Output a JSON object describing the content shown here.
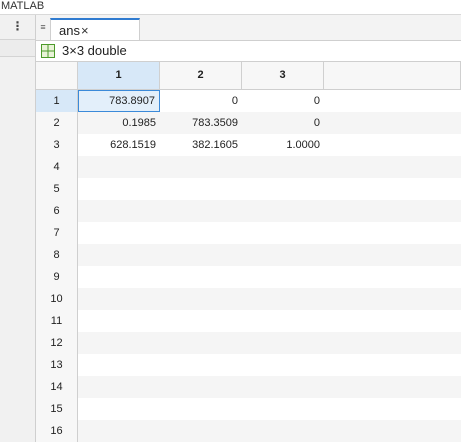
{
  "app": {
    "title": "MATLAB"
  },
  "left_panel": {
    "menu_icon": "kebab-icon"
  },
  "tabs": [
    {
      "label": "ans",
      "close": "×"
    }
  ],
  "variable": {
    "size_label": "3×3 double"
  },
  "columns": [
    "1",
    "2",
    "3",
    ""
  ],
  "rows": [
    {
      "label": "1",
      "cells": [
        "783.8907",
        "0",
        "0",
        ""
      ]
    },
    {
      "label": "2",
      "cells": [
        "0.1985",
        "783.3509",
        "0",
        ""
      ]
    },
    {
      "label": "3",
      "cells": [
        "628.1519",
        "382.1605",
        "1.0000",
        ""
      ]
    },
    {
      "label": "4",
      "cells": [
        "",
        "",
        "",
        ""
      ]
    },
    {
      "label": "5",
      "cells": [
        "",
        "",
        "",
        ""
      ]
    },
    {
      "label": "6",
      "cells": [
        "",
        "",
        "",
        ""
      ]
    },
    {
      "label": "7",
      "cells": [
        "",
        "",
        "",
        ""
      ]
    },
    {
      "label": "8",
      "cells": [
        "",
        "",
        "",
        ""
      ]
    },
    {
      "label": "9",
      "cells": [
        "",
        "",
        "",
        ""
      ]
    },
    {
      "label": "10",
      "cells": [
        "",
        "",
        "",
        ""
      ]
    },
    {
      "label": "11",
      "cells": [
        "",
        "",
        "",
        ""
      ]
    },
    {
      "label": "12",
      "cells": [
        "",
        "",
        "",
        ""
      ]
    },
    {
      "label": "13",
      "cells": [
        "",
        "",
        "",
        ""
      ]
    },
    {
      "label": "14",
      "cells": [
        "",
        "",
        "",
        ""
      ]
    },
    {
      "label": "15",
      "cells": [
        "",
        "",
        "",
        ""
      ]
    },
    {
      "label": "16",
      "cells": [
        "",
        "",
        "",
        ""
      ]
    }
  ],
  "selection": {
    "row": 0,
    "col": 0
  },
  "colors": {
    "accent": "#2f7bd0",
    "selected_header": "#d7e8f8"
  }
}
